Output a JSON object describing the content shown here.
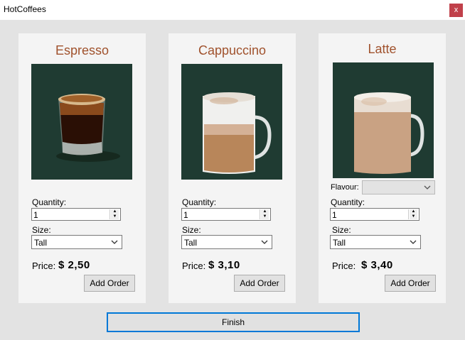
{
  "window": {
    "title": "HotCoffees",
    "close_label": "x"
  },
  "products": [
    {
      "name": "Espresso",
      "quantity_label": "Quantity:",
      "quantity": "1",
      "size_label": "Size:",
      "size": "Tall",
      "price_label": "Price:",
      "price": "$  2,50",
      "add_label": "Add Order"
    },
    {
      "name": "Cappuccino",
      "quantity_label": "Quantity:",
      "quantity": "1",
      "size_label": "Size:",
      "size": "Tall",
      "price_label": "Price:",
      "price": "$  3,10",
      "add_label": "Add Order"
    },
    {
      "name": "Latte",
      "flavour_label": "Flavour:",
      "flavour": "",
      "quantity_label": "Quantity:",
      "quantity": "1",
      "size_label": "Size:",
      "size": "Tall",
      "price_label": "Price:",
      "price": "$ 3,40",
      "add_label": "Add Order"
    }
  ],
  "finish_label": "Finish",
  "colors": {
    "product_name": "#a0522d",
    "photo_bg": "#1f3b32",
    "focus_border": "#0078d7",
    "close_bg": "#c0404a"
  }
}
